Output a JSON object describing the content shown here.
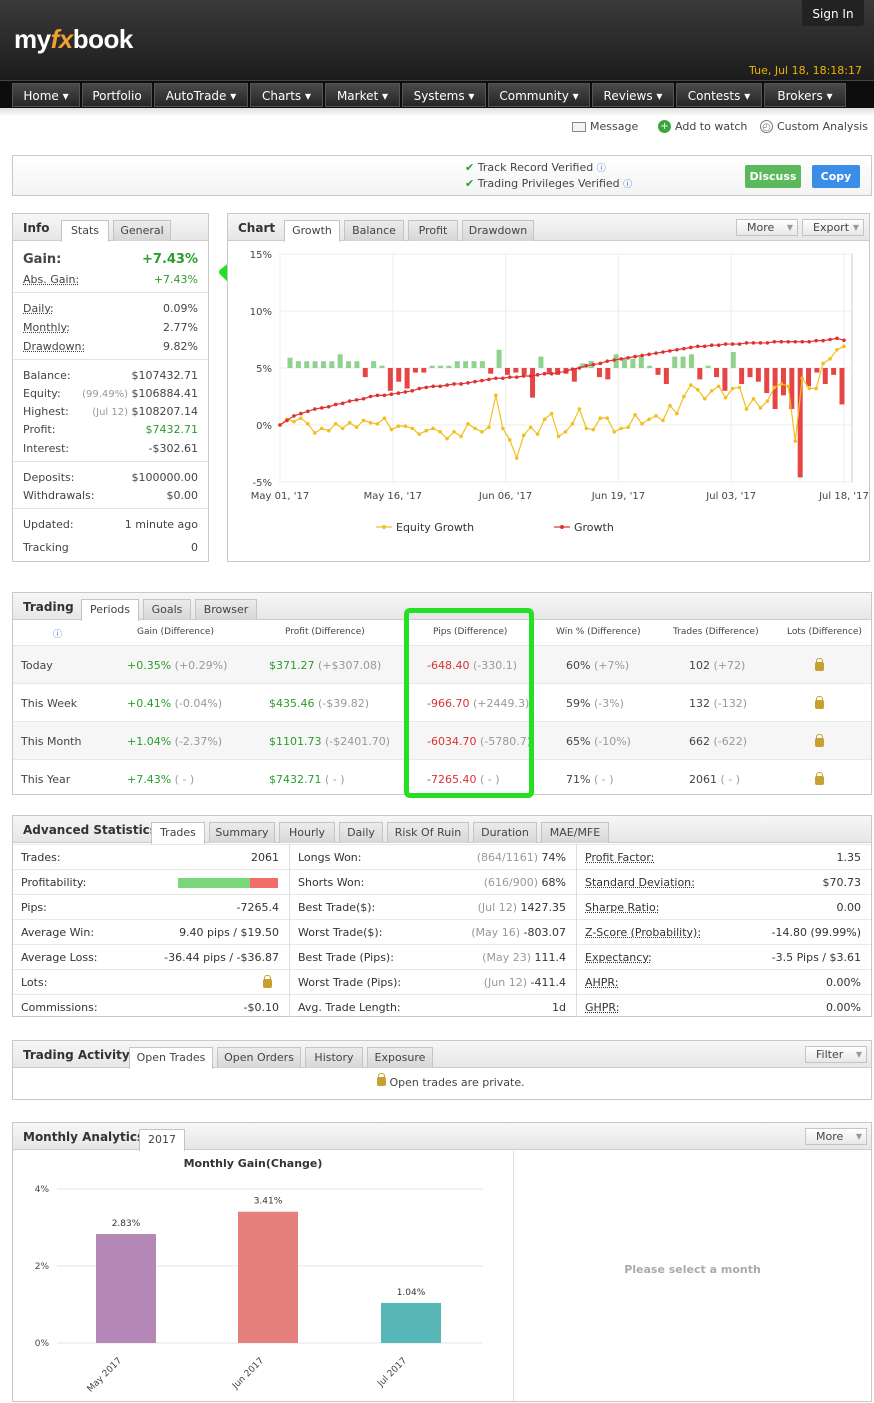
{
  "header": {
    "logo_pre": "my",
    "logo_fx": "fx",
    "logo_post": "book",
    "sign_in": "Sign In",
    "datetime": "Tue, Jul 18, 18:18:17"
  },
  "nav": [
    "Home ▾",
    "Portfolio",
    "AutoTrade ▾",
    "Charts ▾",
    "Market ▾",
    "Systems ▾",
    "Community ▾",
    "Reviews ▾",
    "Contests ▾",
    "Brokers ▾"
  ],
  "toplinks": {
    "message": "Message",
    "add_watch": "Add to watch",
    "custom": "Custom Analysis"
  },
  "verify": {
    "track": "Track Record Verified",
    "trading": "Trading Privileges Verified",
    "discuss": "Discuss",
    "copy": "Copy"
  },
  "info": {
    "title": "Info",
    "tabs": [
      "Stats",
      "General"
    ],
    "gain_label": "Gain:",
    "gain_value": "+7.43%",
    "abs_label": "Abs. Gain:",
    "abs_value": "+7.43%",
    "daily_label": "Daily:",
    "daily_value": "0.09%",
    "monthly_label": "Monthly:",
    "monthly_value": "2.77%",
    "drawdown_label": "Drawdown:",
    "drawdown_value": "9.82%",
    "balance_label": "Balance:",
    "balance_value": "$107432.71",
    "equity_label": "Equity:",
    "equity_note": "(99.49%)",
    "equity_value": "$106884.41",
    "highest_label": "Highest:",
    "highest_note": "(Jul 12)",
    "highest_value": "$108207.14",
    "profit_label": "Profit:",
    "profit_value": "$7432.71",
    "interest_label": "Interest:",
    "interest_value": "-$302.61",
    "deposits_label": "Deposits:",
    "deposits_value": "$100000.00",
    "withdrawals_label": "Withdrawals:",
    "withdrawals_value": "$0.00",
    "updated_label": "Updated:",
    "updated_value": "1 minute ago",
    "tracking_label": "Tracking",
    "tracking_value": "0"
  },
  "chart_panel": {
    "title": "Chart",
    "tabs": [
      "Growth",
      "Balance",
      "Profit",
      "Drawdown"
    ],
    "more": "More",
    "export": "Export"
  },
  "chart_data": [
    {
      "type": "line",
      "yticks": [
        "15%",
        "10%",
        "5%",
        "0%",
        "-5%"
      ],
      "ylim": [
        -5,
        15
      ],
      "xticks": [
        "May 01, '17",
        "May 16, '17",
        "Jun 06, '17",
        "Jun 19, '17",
        "Jul 03, '17",
        "Jul 18, '17"
      ],
      "series": [
        {
          "name": "Equity Growth",
          "color": "#f0c020",
          "values": [
            0,
            0.5,
            0.3,
            0.6,
            0.1,
            -0.7,
            -0.3,
            -0.5,
            0.1,
            -0.3,
            0.2,
            -0.2,
            0.4,
            0.2,
            0.1,
            0.6,
            -0.4,
            -0.1,
            -0.1,
            -0.3,
            -0.8,
            -0.5,
            -0.3,
            -0.6,
            -1.2,
            -0.6,
            -1.0,
            0.1,
            -0.3,
            -0.6,
            -0.2,
            2.6,
            -0.3,
            -1.3,
            -2.9,
            -0.9,
            -0.2,
            -0.8,
            0.5,
            1.0,
            -1.0,
            -0.6,
            0.1,
            1.4,
            -0.3,
            -0.4,
            0.6,
            0.6,
            -0.6,
            -0.3,
            -0.2,
            0.9,
            0.1,
            0.5,
            0.8,
            0.4,
            1.7,
            1.0,
            2.5,
            3.5,
            3.1,
            2.3,
            3.0,
            3.4,
            2.4,
            3.2,
            3.3,
            1.4,
            2.3,
            1.5,
            2.1,
            3.3,
            3.6,
            3.4,
            -1.4,
            4.1,
            3.2,
            3.2,
            5.4,
            5.8,
            6.6,
            6.9
          ]
        },
        {
          "name": "Growth",
          "color": "#e03030",
          "values": [
            0,
            0.4,
            0.8,
            1.0,
            1.2,
            1.4,
            1.5,
            1.6,
            1.8,
            1.9,
            2.1,
            2.2,
            2.3,
            2.5,
            2.6,
            2.6,
            2.7,
            2.8,
            2.9,
            3.0,
            3.2,
            3.3,
            3.4,
            3.4,
            3.5,
            3.6,
            3.6,
            3.7,
            3.8,
            3.9,
            4.0,
            4.1,
            4.1,
            4.2,
            4.2,
            4.3,
            4.3,
            4.4,
            4.5,
            4.5,
            4.6,
            4.7,
            4.9,
            5.0,
            5.2,
            5.3,
            5.4,
            5.6,
            5.7,
            5.8,
            5.9,
            6.0,
            6.1,
            6.2,
            6.3,
            6.4,
            6.5,
            6.6,
            6.7,
            6.8,
            6.9,
            6.9,
            7.0,
            7.0,
            7.1,
            7.1,
            7.1,
            7.2,
            7.2,
            7.2,
            7.2,
            7.3,
            7.3,
            7.3,
            7.3,
            7.3,
            7.3,
            7.4,
            7.4,
            7.5,
            7.6,
            7.43
          ]
        }
      ],
      "bars": [
        0.9,
        0.6,
        0.6,
        0.6,
        0.6,
        0.6,
        1.2,
        0.6,
        0.6,
        -0.8,
        0.6,
        0.2,
        -2.0,
        -1.2,
        -1.8,
        -0.4,
        -0.4,
        0.2,
        0.2,
        0.2,
        0.6,
        0.6,
        0.6,
        0.6,
        -0.5,
        1.6,
        -0.6,
        -0.4,
        -0.6,
        -2.6,
        1.0,
        -0.5,
        -0.6,
        -0.5,
        -1.2,
        0.4,
        0.6,
        -0.8,
        -1.0,
        1.2,
        0.8,
        0.8,
        1.0,
        0.2,
        -0.6,
        -1.4,
        1.0,
        1.0,
        1.2,
        -1.0,
        0.2,
        -0.8,
        -2.0,
        1.4,
        -1.4,
        -0.8,
        -1.2,
        -2.2,
        -3.6,
        -2.4,
        -3.6,
        -9.6,
        -1.6,
        -0.4,
        -1.4,
        -0.6,
        -3.2
      ],
      "legend": [
        "Equity Growth",
        "Growth"
      ]
    },
    {
      "type": "bar",
      "title": "Monthly Gain(Change)",
      "categories": [
        "May 2017",
        "Jun 2017",
        "Jul 2017"
      ],
      "values": [
        2.83,
        3.41,
        1.04
      ],
      "labels": [
        "2.83%",
        "3.41%",
        "1.04%"
      ],
      "colors": [
        "#b487b6",
        "#e5807c",
        "#56b7b6"
      ],
      "yticks": [
        "4%",
        "2%",
        "0%"
      ],
      "ylim": [
        0,
        4
      ]
    }
  ],
  "trading": {
    "title": "Trading",
    "tabs": [
      "Periods",
      "Goals",
      "Browser"
    ],
    "headers": [
      "Gain (Difference)",
      "Profit (Difference)",
      "Pips (Difference)",
      "Win % (Difference)",
      "Trades (Difference)",
      "Lots (Difference)"
    ],
    "rows": [
      {
        "label": "Today",
        "gain": "+0.35%",
        "gain_d": "(+0.29%)",
        "profit": "$371.27",
        "profit_d": "(+$307.08)",
        "pips": "-648.40",
        "pips_d": "(-330.1)",
        "win": "60%",
        "win_d": "(+7%)",
        "trades": "102",
        "trades_d": "(+72)"
      },
      {
        "label": "This Week",
        "gain": "+0.41%",
        "gain_d": "(-0.04%)",
        "profit": "$435.46",
        "profit_d": "(-$39.82)",
        "pips": "-966.70",
        "pips_d": "(+2449.3)",
        "win": "59%",
        "win_d": "(-3%)",
        "trades": "132",
        "trades_d": "(-132)"
      },
      {
        "label": "This Month",
        "gain": "+1.04%",
        "gain_d": "(-2.37%)",
        "profit": "$1101.73",
        "profit_d": "(-$2401.70)",
        "pips": "-6034.70",
        "pips_d": "(-5780.7)",
        "win": "65%",
        "win_d": "(-10%)",
        "trades": "662",
        "trades_d": "(-622)"
      },
      {
        "label": "This Year",
        "gain": "+7.43%",
        "gain_d": "( - )",
        "profit": "$7432.71",
        "profit_d": "( - )",
        "pips": "-7265.40",
        "pips_d": "( - )",
        "win": "71%",
        "win_d": "( - )",
        "trades": "2061",
        "trades_d": "( - )"
      }
    ]
  },
  "advanced": {
    "title": "Advanced Statistics",
    "tabs": [
      "Trades",
      "Summary",
      "Hourly",
      "Daily",
      "Risk Of Ruin",
      "Duration",
      "MAE/MFE"
    ],
    "col1": [
      {
        "label": "Trades:",
        "value": "2061"
      },
      {
        "label": "Profitability:",
        "value": ""
      },
      {
        "label": "Pips:",
        "value": "-7265.4"
      },
      {
        "label": "Average Win:",
        "value": "9.40 pips / $19.50"
      },
      {
        "label": "Average Loss:",
        "value": "-36.44 pips / -$36.87"
      },
      {
        "label": "Lots:",
        "value": ""
      },
      {
        "label": "Commissions:",
        "value": "-$0.10"
      }
    ],
    "col2": [
      {
        "label": "Longs Won:",
        "note": "(864/1161)",
        "value": "74%"
      },
      {
        "label": "Shorts Won:",
        "note": "(616/900)",
        "value": "68%"
      },
      {
        "label": "Best Trade($):",
        "note": "(Jul 12)",
        "value": "1427.35"
      },
      {
        "label": "Worst Trade($):",
        "note": "(May 16)",
        "value": "-803.07"
      },
      {
        "label": "Best Trade (Pips):",
        "note": "(May 23)",
        "value": "111.4"
      },
      {
        "label": "Worst Trade (Pips):",
        "note": "(Jun 12)",
        "value": "-411.4"
      },
      {
        "label": "Avg. Trade Length:",
        "note": "",
        "value": "1d"
      }
    ],
    "col3": [
      {
        "label": "Profit Factor:",
        "value": "1.35"
      },
      {
        "label": "Standard Deviation:",
        "value": "$70.73"
      },
      {
        "label": "Sharpe Ratio:",
        "value": "0.00"
      },
      {
        "label": "Z-Score (Probability):",
        "value": "-14.80 (99.99%)"
      },
      {
        "label": "Expectancy:",
        "value": "-3.5 Pips / $3.61"
      },
      {
        "label": "AHPR:",
        "value": "0.00%"
      },
      {
        "label": "GHPR:",
        "value": "0.00%"
      }
    ],
    "profitability_fraction": 0.72
  },
  "activity": {
    "title": "Trading Activity",
    "tabs": [
      "Open Trades",
      "Open Orders",
      "History",
      "Exposure"
    ],
    "filter": "Filter",
    "private": "Open trades are private."
  },
  "monthly": {
    "title": "Monthly Analytics",
    "tab": "2017",
    "more": "More",
    "select": "Please select a month"
  },
  "colors": {
    "accent_green": "#2a9d2a",
    "accent_red": "#d63333",
    "copy_blue": "#3b8ee8",
    "discuss_green": "#5cb85c",
    "annotation": "#22e022"
  }
}
